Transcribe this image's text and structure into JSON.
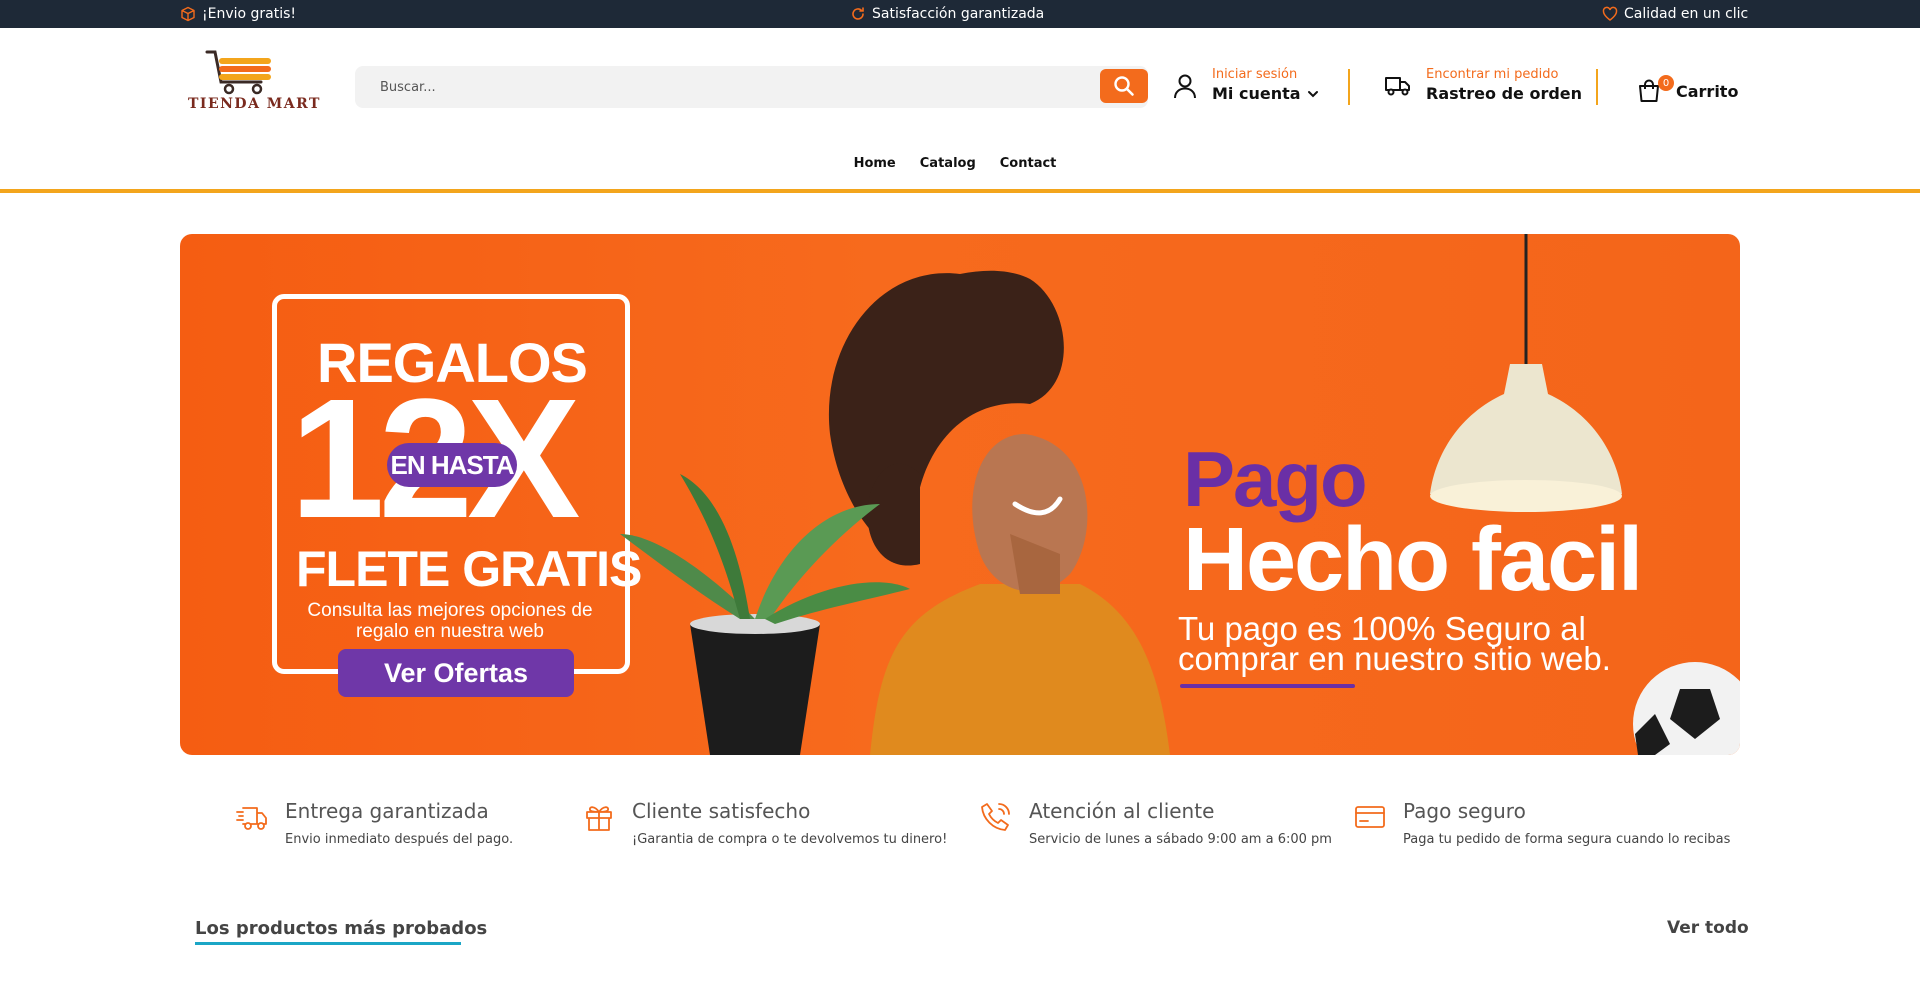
{
  "topbar": {
    "shipping": "¡Envio gratis!",
    "satisfaction": "Satisfacción garantizada",
    "quality": "Calidad en un clic"
  },
  "brand": {
    "name": "TIENDA MART"
  },
  "search": {
    "placeholder": "Buscar..."
  },
  "account": {
    "login_label": "Iniciar sesión",
    "account_label": "Mi cuenta"
  },
  "tracking": {
    "label_small": "Encontrar mi pedido",
    "label_big": "Rastreo de orden"
  },
  "cart": {
    "count": "0",
    "label": "Carrito"
  },
  "nav": {
    "home": "Home",
    "catalog": "Catalog",
    "contact": "Contact"
  },
  "hero": {
    "left": {
      "regalos": "REGALOS",
      "big": "12X",
      "pill": "EN HASTA",
      "flete": "FLETE GRATIS",
      "consulta": "Consulta las mejores opciones de regalo en nuestra web",
      "cta": "Ver Ofertas"
    },
    "right": {
      "pago": "Pago",
      "hecho": "Hecho facil",
      "tagline_1": "Tu pago es 100% Seguro al",
      "tagline_2": "comprar en nuestro sitio web."
    }
  },
  "features": [
    {
      "icon": "fast-delivery-icon",
      "title": "Entrega garantizada",
      "desc": "Envio inmediato después del pago."
    },
    {
      "icon": "gift-box-icon",
      "title": "Cliente satisfecho",
      "desc": "¡Garantia de compra o te devolvemos tu dinero!"
    },
    {
      "icon": "phone-call-icon",
      "title": "Atención al cliente",
      "desc": "Servicio de lunes a sábado 9:00 am a 6:00 pm"
    },
    {
      "icon": "credit-card-icon",
      "title": "Pago seguro",
      "desc": "Paga tu pedido de forma segura cuando lo recibas"
    }
  ],
  "section": {
    "title": "Los productos más probados",
    "see_all": "Ver todo"
  },
  "colors": {
    "accent": "#f36b1c",
    "topbar": "#1e2937",
    "rule": "#f3a51c",
    "purple": "#6f37a8",
    "teal": "#1ba6c6"
  }
}
